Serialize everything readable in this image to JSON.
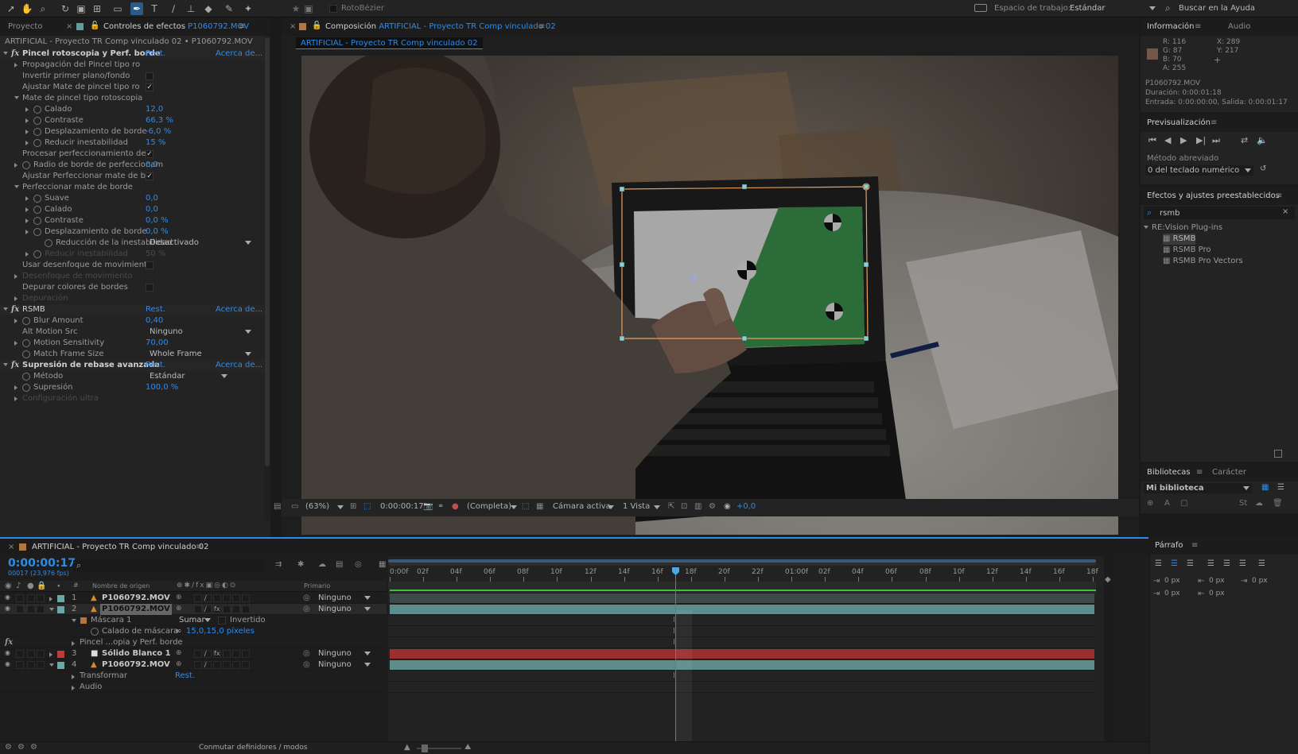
{
  "toolbar": {
    "rotobezier_label": "RotoBézier",
    "workspace_label": "Espacio de trabajo:",
    "workspace_value": "Estándar",
    "help_search": "Buscar en la Ayuda"
  },
  "effects_panel": {
    "tab_project": "Proyecto",
    "tab_effects": "Controles de efectos",
    "tab_effects_file": "P1060792.MOV",
    "breadcrumb": "ARTIFICIAL - Proyecto TR Comp vinculado 02 • P1060792.MOV",
    "reset": "Rest.",
    "about": "Acerca de...",
    "rows": [
      {
        "indent": 0,
        "tri": "open",
        "fx": true,
        "label": "Pincel rotoscopia y Perf. borde",
        "reset": true,
        "header": true
      },
      {
        "indent": 1,
        "tri": "closed",
        "label": "Propagación del Pincel tipo ro"
      },
      {
        "indent": 1,
        "label": "Invertir primer plano/fondo",
        "check": ""
      },
      {
        "indent": 1,
        "label": "Ajustar Mate de pincel tipo ro",
        "check": "✓"
      },
      {
        "indent": 1,
        "tri": "open",
        "label": "Mate de pincel tipo rotoscopia"
      },
      {
        "indent": 2,
        "tri": "closed",
        "sw": true,
        "label": "Calado",
        "value": "12,0"
      },
      {
        "indent": 2,
        "tri": "closed",
        "sw": true,
        "label": "Contraste",
        "value": "66,3 %"
      },
      {
        "indent": 2,
        "tri": "closed",
        "sw": true,
        "label": "Desplazamiento de borde",
        "value": "-6,0 %"
      },
      {
        "indent": 2,
        "tri": "closed",
        "sw": true,
        "label": "Reducir inestabilidad",
        "value": "15 %"
      },
      {
        "indent": 1,
        "label": "Procesar perfeccionamiento de",
        "check": "✓"
      },
      {
        "indent": 1,
        "tri": "closed",
        "sw": true,
        "label": "Radio de borde de perfeccionam",
        "value": "0,0"
      },
      {
        "indent": 1,
        "label": "Ajustar Perfeccionar mate de b",
        "check": "✓"
      },
      {
        "indent": 1,
        "tri": "open",
        "label": "Perfeccionar mate de borde"
      },
      {
        "indent": 2,
        "tri": "closed",
        "sw": true,
        "label": "Suave",
        "value": "0,0"
      },
      {
        "indent": 2,
        "tri": "closed",
        "sw": true,
        "label": "Calado",
        "value": "0,0"
      },
      {
        "indent": 2,
        "tri": "closed",
        "sw": true,
        "label": "Contraste",
        "value": "0,0 %"
      },
      {
        "indent": 2,
        "tri": "closed",
        "sw": true,
        "label": "Desplazamiento de borde",
        "value": "0,0 %"
      },
      {
        "indent": 3,
        "sw": true,
        "label": "Reducción de la inestabilidad",
        "dropdown": "Desactivado"
      },
      {
        "indent": 2,
        "tri": "closed",
        "sw": true,
        "label": "Reducir inestabilidad",
        "value": "50 %",
        "disabled": true
      },
      {
        "indent": 1,
        "label": "Usar desenfoque de movimiento",
        "check": ""
      },
      {
        "indent": 1,
        "tri": "closed",
        "label": "Desenfoque de movimiento",
        "disabled": true
      },
      {
        "indent": 1,
        "label": "Depurar colores de bordes",
        "check": ""
      },
      {
        "indent": 1,
        "tri": "closed",
        "label": "Depuración",
        "disabled": true
      },
      {
        "indent": 0,
        "tri": "open",
        "fx": true,
        "label": "RSMB",
        "reset": true,
        "header": false
      },
      {
        "indent": 1,
        "tri": "closed",
        "sw": true,
        "label": "Blur Amount",
        "value": "0,40"
      },
      {
        "indent": 1,
        "label": "Alt Motion Src",
        "dropdown": "Ninguno"
      },
      {
        "indent": 1,
        "tri": "closed",
        "sw": true,
        "label": "Motion Sensitivity",
        "value": "70,00"
      },
      {
        "indent": 1,
        "sw": true,
        "label": "Match Frame Size",
        "dropdown": "Whole Frame"
      },
      {
        "indent": 0,
        "tri": "open",
        "fx": true,
        "label": "Supresión de rebase avanzada",
        "reset": true,
        "header": true
      },
      {
        "indent": 1,
        "sw": true,
        "label": "Método",
        "dropdown": "Estándar"
      },
      {
        "indent": 1,
        "tri": "closed",
        "sw": true,
        "label": "Supresión",
        "value": "100,0 %"
      },
      {
        "indent": 1,
        "tri": "closed",
        "label": "Configuración ultra",
        "disabled": true
      }
    ]
  },
  "composition": {
    "tab_prefix": "Composición",
    "tab_name": "ARTIFICIAL - Proyecto TR Comp vinculado 02",
    "subtab": "ARTIFICIAL - Proyecto TR Comp vinculado 02",
    "zoom": "(63%)",
    "timecode": "0:00:00:17",
    "resolution": "(Completa)",
    "camera": "Cámara activa",
    "views": "1 Vista",
    "exposure": "+0,0"
  },
  "info_panel": {
    "tab_info": "Información",
    "tab_audio": "Audio",
    "r": "R:  116",
    "g": "G:  87",
    "b": "B:  70",
    "a": "A:  255",
    "x": "X:  289",
    "y": "Y:  217",
    "file": "P1060792.MOV",
    "duration": "Duración: 0:00:01:18",
    "inout": "Entrada: 0:00:00:00, Salida: 0:00:01:17",
    "swatch_color": "#74574a"
  },
  "preview_panel": {
    "title": "Previsualización",
    "shortcut_label": "Método abreviado",
    "shortcut_value": "0 del teclado numérico"
  },
  "presets_panel": {
    "title": "Efectos y ajustes preestablecidos",
    "search": "rsmb",
    "folder": "RE:Vision Plug-ins",
    "items": [
      "RSMB",
      "RSMB Pro",
      "RSMB Pro Vectors"
    ]
  },
  "libraries_panel": {
    "tab_libraries": "Bibliotecas",
    "tab_character": "Carácter",
    "library": "Mi biblioteca"
  },
  "paragraph_panel": {
    "title": "Párrafo",
    "fields": [
      "0 px",
      "0 px",
      "0 px",
      "0 px",
      "0 px"
    ]
  },
  "timeline": {
    "tab": "ARTIFICIAL - Proyecto TR Comp vinculado 02",
    "timecode": "0:00:00:17",
    "fps": "00017 (23,976 fps)",
    "col_num": "#",
    "col_source": "Nombre de origen",
    "col_parent": "Primario",
    "ruler": [
      "0:00f",
      "02f",
      "04f",
      "06f",
      "08f",
      "10f",
      "12f",
      "14f",
      "16f",
      "18f",
      "20f",
      "22f",
      "01:00f",
      "02f",
      "04f",
      "06f",
      "08f",
      "10f",
      "12f",
      "14f",
      "16f",
      "18f"
    ],
    "rows": [
      {
        "type": "layer",
        "num": "1",
        "name": "P1060792.MOV",
        "color": "#6aa8a8",
        "parent": "Ninguno",
        "icon": "cone",
        "fx": false,
        "selected": false
      },
      {
        "type": "layer",
        "num": "2",
        "name": "P1060792.MOV",
        "color": "#6aa8a8",
        "parent": "Ninguno",
        "icon": "cone",
        "fx": true,
        "selected": true
      },
      {
        "type": "prop",
        "label": "Máscara 1",
        "mode": "Sumar",
        "inverted": "Invertido",
        "swatch": "#b07840"
      },
      {
        "type": "prop2",
        "label": "Calado de máscara",
        "value": "15,0,15,0 píxeles"
      },
      {
        "type": "prop",
        "label": "Pincel ...opia y Perf. borde"
      },
      {
        "type": "layer",
        "num": "3",
        "name": "Sólido Blanco 1",
        "color": "#c03a3a",
        "parent": "Ninguno",
        "icon": "solid",
        "fx": true,
        "selected": false
      },
      {
        "type": "layer",
        "num": "4",
        "name": "P1060792.MOV",
        "color": "#6aa8a8",
        "parent": "Ninguno",
        "icon": "cone",
        "fx": false,
        "selected": false
      },
      {
        "type": "prop",
        "label": "Transformar",
        "value": "Rest."
      },
      {
        "type": "prop",
        "label": "Audio"
      }
    ],
    "footer": "Conmutar definidores / modos"
  },
  "colors": {
    "accent_blue": "#2d8ceb",
    "green_screen": "#3e9650",
    "track_teal": "#5c8c8c",
    "track_red": "#9a2f2f",
    "playhead": "#d05050"
  }
}
